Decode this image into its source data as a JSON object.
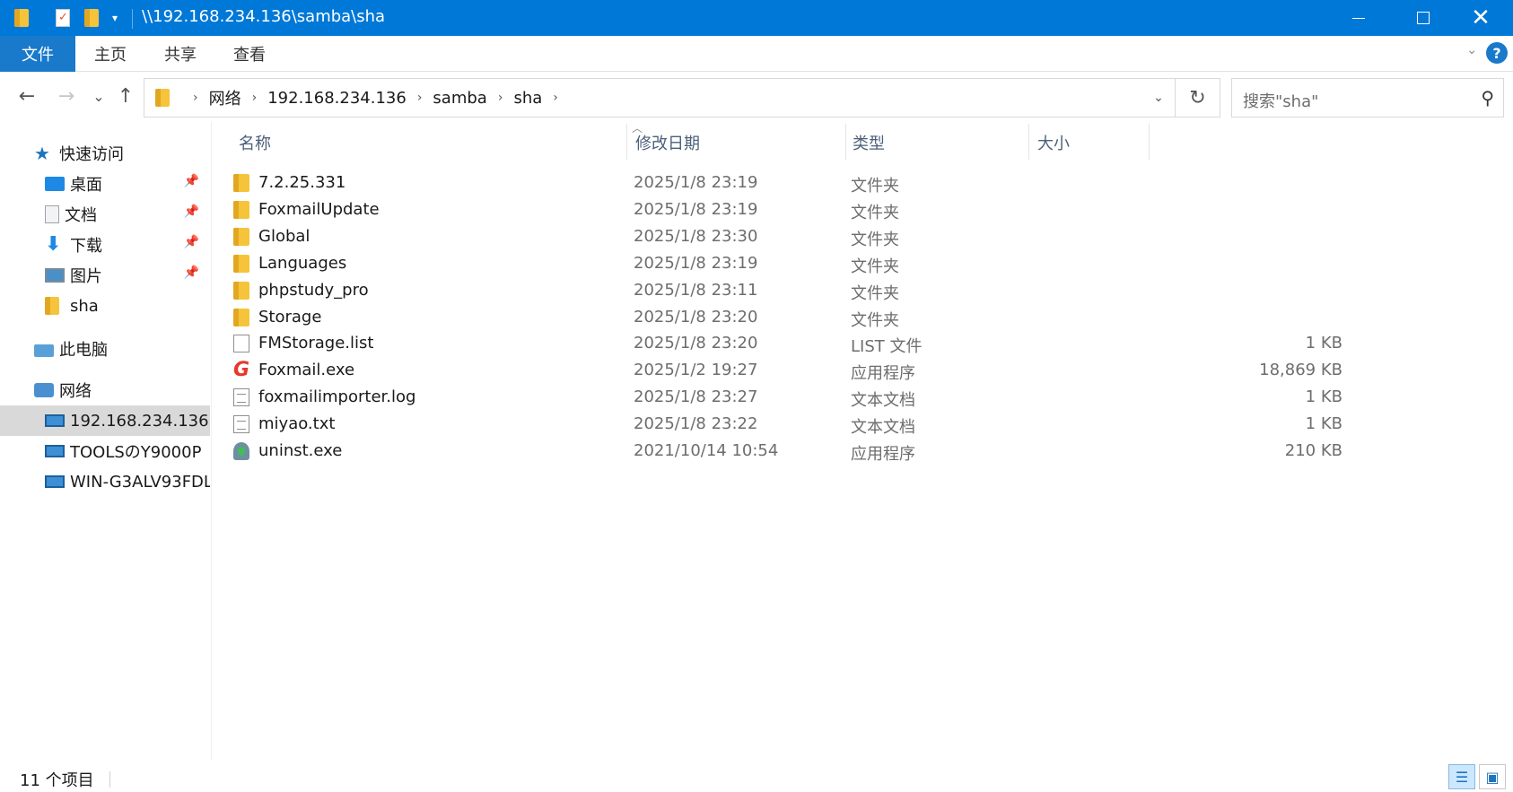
{
  "window": {
    "title": "\\\\192.168.234.136\\samba\\sha"
  },
  "ribbon": {
    "tabs": [
      "文件",
      "主页",
      "共享",
      "查看"
    ],
    "help_label": "?"
  },
  "nav": {
    "back_glyph": "←",
    "forward_glyph": "→",
    "recent_glyph": "⌄",
    "up_glyph": "↑",
    "breadcrumbs": [
      "网络",
      "192.168.234.136",
      "samba",
      "sha"
    ],
    "crumb_sep": "›",
    "refresh_glyph": "↻",
    "search_placeholder": "搜索\"sha\"",
    "search_glyph": "⚲"
  },
  "sidebar": {
    "quick_access": "快速访问",
    "items": [
      {
        "label": "桌面",
        "icon": "desktop-icon",
        "pinned": true
      },
      {
        "label": "文档",
        "icon": "documents-icon",
        "pinned": true
      },
      {
        "label": "下载",
        "icon": "downloads-icon",
        "pinned": true
      },
      {
        "label": "图片",
        "icon": "pictures-icon",
        "pinned": true
      },
      {
        "label": "sha",
        "icon": "folder-icon",
        "pinned": false
      }
    ],
    "this_pc": "此电脑",
    "network": "网络",
    "network_items": [
      "192.168.234.136",
      "TOOLSのY9000P",
      "WIN-G3ALV93FDL"
    ],
    "pin_glyph": "📌"
  },
  "columns": [
    "名称",
    "修改日期",
    "类型",
    "大小"
  ],
  "files": [
    {
      "name": "7.2.25.331",
      "date": "2025/1/8 23:19",
      "type": "文件夹",
      "size": "",
      "icon": "folder"
    },
    {
      "name": "FoxmailUpdate",
      "date": "2025/1/8 23:19",
      "type": "文件夹",
      "size": "",
      "icon": "folder"
    },
    {
      "name": "Global",
      "date": "2025/1/8 23:30",
      "type": "文件夹",
      "size": "",
      "icon": "folder"
    },
    {
      "name": "Languages",
      "date": "2025/1/8 23:19",
      "type": "文件夹",
      "size": "",
      "icon": "folder"
    },
    {
      "name": "phpstudy_pro",
      "date": "2025/1/8 23:11",
      "type": "文件夹",
      "size": "",
      "icon": "folder"
    },
    {
      "name": "Storage",
      "date": "2025/1/8 23:20",
      "type": "文件夹",
      "size": "",
      "icon": "folder"
    },
    {
      "name": "FMStorage.list",
      "date": "2025/1/8 23:20",
      "type": "LIST 文件",
      "size": "1 KB",
      "icon": "file"
    },
    {
      "name": "Foxmail.exe",
      "date": "2025/1/2 19:27",
      "type": "应用程序",
      "size": "18,869 KB",
      "icon": "foxmail"
    },
    {
      "name": "foxmailimporter.log",
      "date": "2025/1/8 23:27",
      "type": "文本文档",
      "size": "1 KB",
      "icon": "text"
    },
    {
      "name": "miyao.txt",
      "date": "2025/1/8 23:22",
      "type": "文本文档",
      "size": "1 KB",
      "icon": "text"
    },
    {
      "name": "uninst.exe",
      "date": "2021/10/14 10:54",
      "type": "应用程序",
      "size": "210 KB",
      "icon": "uninst"
    }
  ],
  "status": {
    "item_count": "11 个项目"
  },
  "colors": {
    "titlebar": "#0078d7",
    "file_tab": "#1979ca",
    "selection": "#cce8ff"
  }
}
